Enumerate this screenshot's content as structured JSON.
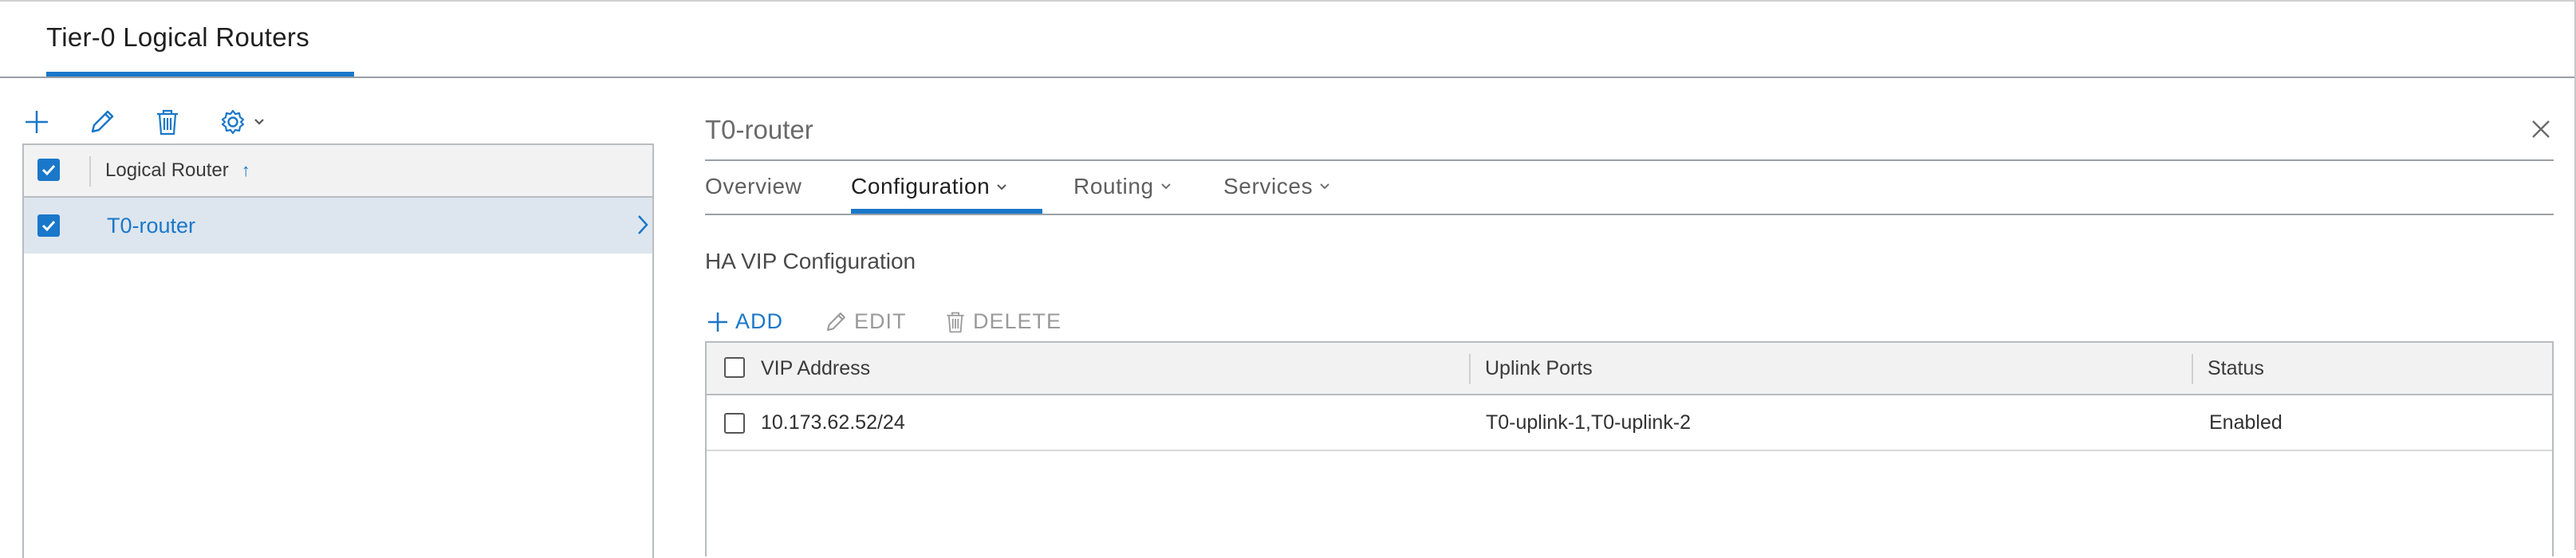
{
  "header": {
    "tab_title": "Tier-0 Logical Routers"
  },
  "left_toolbar": {
    "icons": [
      "add-icon",
      "edit-icon",
      "delete-icon",
      "gear-icon",
      "chevron-down-icon"
    ]
  },
  "router_grid": {
    "column_header": "Logical Router",
    "sort_indicator": "↑",
    "rows": [
      {
        "name": "T0-router",
        "checked": true,
        "selected": true
      }
    ]
  },
  "detail": {
    "title": "T0-router",
    "tabs": [
      {
        "label": "Overview",
        "has_menu": false,
        "active": false
      },
      {
        "label": "Configuration",
        "has_menu": true,
        "active": true
      },
      {
        "label": "Routing",
        "has_menu": true,
        "active": false
      },
      {
        "label": "Services",
        "has_menu": true,
        "active": false
      }
    ],
    "section_title": "HA VIP Configuration",
    "actions": {
      "add": "ADD",
      "edit": "EDIT",
      "delete": "DELETE"
    },
    "vip_grid": {
      "headers": {
        "vip": "VIP Address",
        "uplink": "Uplink Ports",
        "status": "Status"
      },
      "rows": [
        {
          "vip": "10.173.62.52/24",
          "uplink": "T0-uplink-1,T0-uplink-2",
          "status": "Enabled"
        }
      ]
    }
  },
  "colors": {
    "accent": "#1a77c9",
    "selected_row": "#dde6ee",
    "header_bg": "#f2f2f2"
  }
}
